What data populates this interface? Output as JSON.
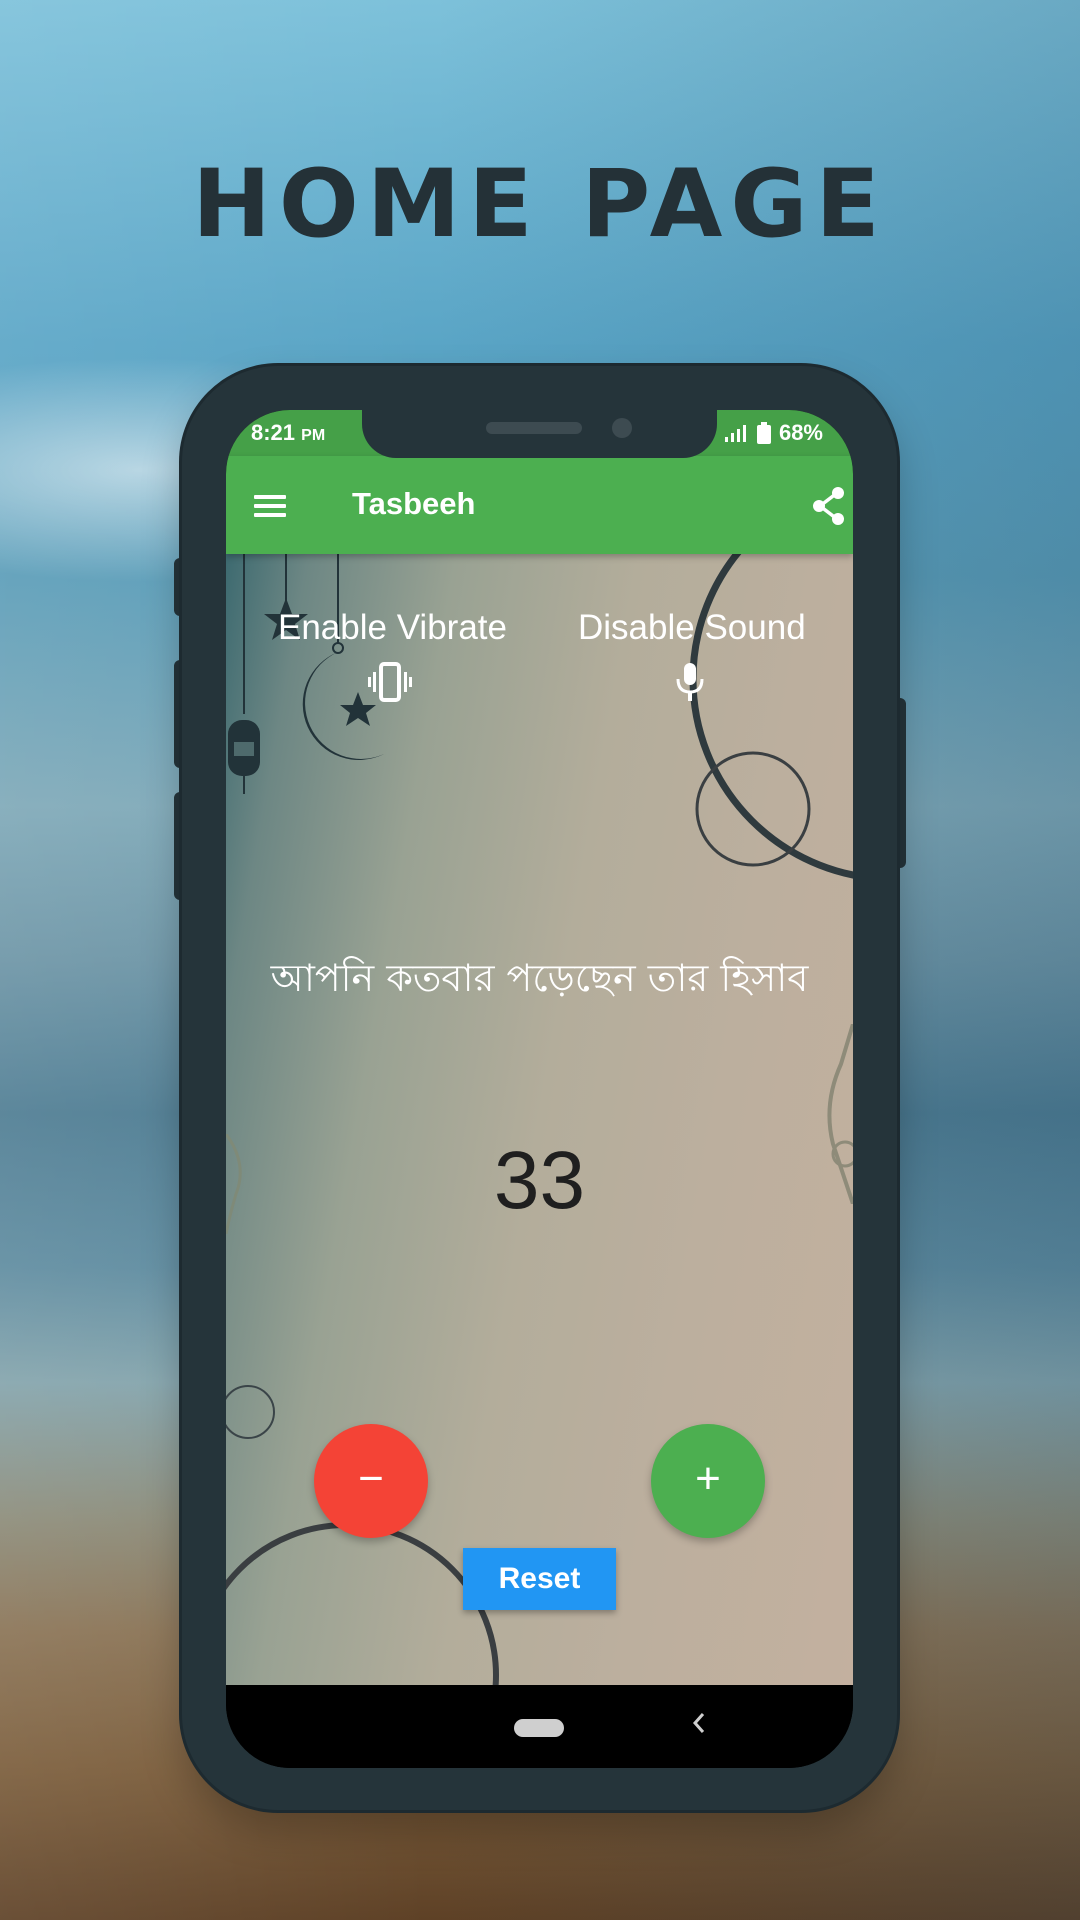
{
  "headline": "HOME PAGE",
  "status_bar": {
    "time": "8:21",
    "ampm": "PM",
    "battery": "68%"
  },
  "app_bar": {
    "title": "Tasbeeh",
    "menu_icon": "hamburger-menu-icon",
    "share_icon": "share-icon"
  },
  "toggles": {
    "vibrate": {
      "label": "Enable Vibrate",
      "icon": "vibrate-icon"
    },
    "sound": {
      "label": "Disable Sound",
      "icon": "microphone-icon"
    }
  },
  "prompt": "আপনি কতবার পড়েছেন তার হিসাব",
  "counter": "33",
  "buttons": {
    "minus": "−",
    "plus": "+",
    "reset": "Reset"
  },
  "colors": {
    "app_bar": "#4caf50",
    "minus_button": "#f44336",
    "plus_button": "#4caf50",
    "reset_button": "#2196f3"
  }
}
